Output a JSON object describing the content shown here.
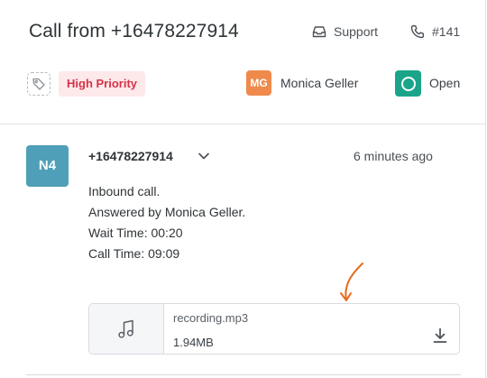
{
  "header": {
    "title": "Call from +16478227914",
    "support_label": "Support",
    "ticket_label": "#141"
  },
  "tags": {
    "priority": "High Priority",
    "priority_color": "#d6334a",
    "agent_initials": "MG",
    "agent_name": "Monica Geller",
    "agent_color": "#ef8a4c",
    "status": "Open",
    "status_color": "#1aa58a"
  },
  "message": {
    "avatar": "N4",
    "avatar_color": "#4f9fb8",
    "caller": "+16478227914",
    "time": "6 minutes ago",
    "lines": [
      "Inbound call.",
      "Answered by Monica Geller.",
      "Wait Time: 00:20",
      "Call Time: 09:09"
    ]
  },
  "attachment": {
    "name": "recording.mp3",
    "size": "1.94MB",
    "icon": "music-note-icon",
    "download_icon": "download-icon"
  },
  "annotation": {
    "icon": "curved-arrow-icon",
    "color": "#e86a1c"
  }
}
